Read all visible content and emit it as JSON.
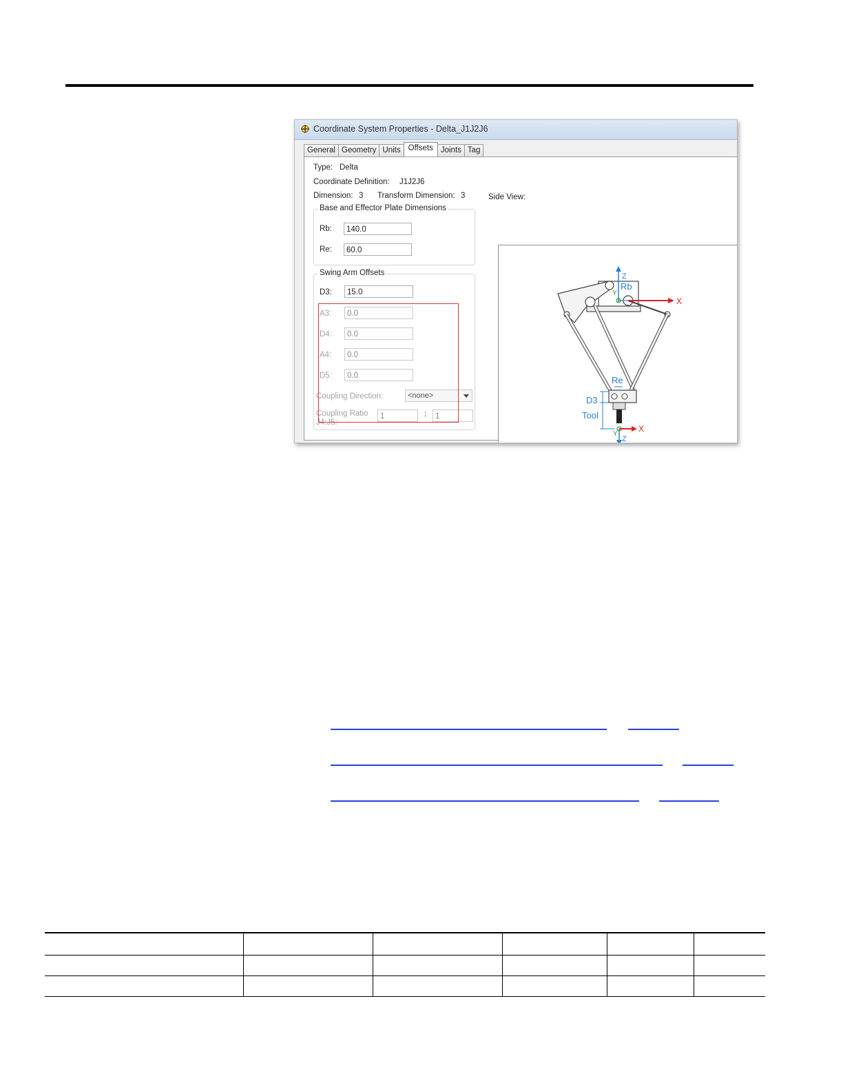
{
  "dialog": {
    "title": "Coordinate System Properties - Delta_J1J2J6",
    "tabs": [
      "General",
      "Geometry",
      "Units",
      "Offsets",
      "Joints",
      "Tag"
    ],
    "active_tab": "Offsets",
    "type_label": "Type:",
    "type_value": "Delta",
    "coord_def_label": "Coordinate Definition:",
    "coord_def_value": "J1J2J6",
    "dimension_label": "Dimension:",
    "dimension_value": "3",
    "transform_label": "Transform Dimension:",
    "transform_value": "3",
    "base_group_title": "Base and Effector Plate Dimensions",
    "rb_label": "Rb:",
    "rb_value": "140.0",
    "re_label": "Re:",
    "re_value": "60.0",
    "swing_group_title": "Swing Arm Offsets",
    "d3_label": "D3:",
    "d3_value": "15.0",
    "a3_label": "A3:",
    "a3_value": "0.0",
    "d4_label": "D4:",
    "d4_value": "0.0",
    "a4_label": "A4:",
    "a4_value": "0.0",
    "d5_label": "D5:",
    "d5_value": "0.0",
    "coupling_dir_label": "Coupling Direction:",
    "coupling_dir_value": "<none>",
    "coupling_ratio_label1": "Coupling Ratio",
    "coupling_ratio_label2": "J4:J5:",
    "ratio_a": "1",
    "ratio_sep": ":",
    "ratio_b": "1",
    "side_view_label": "Side View:",
    "diagram_labels": {
      "z_top": "Z",
      "rb": "Rb",
      "y_top": "Y",
      "x_top": "X",
      "re": "Re",
      "d3": "D3",
      "tool": "Tool",
      "y_bottom": "Y",
      "x_bottom": "X",
      "z_bottom": "Z"
    }
  },
  "colors": {
    "highlight_box": "#e0343a",
    "axis_blue": "#2a7fd4",
    "axis_red": "#e02020",
    "link_blue": "#2a3fd6"
  }
}
